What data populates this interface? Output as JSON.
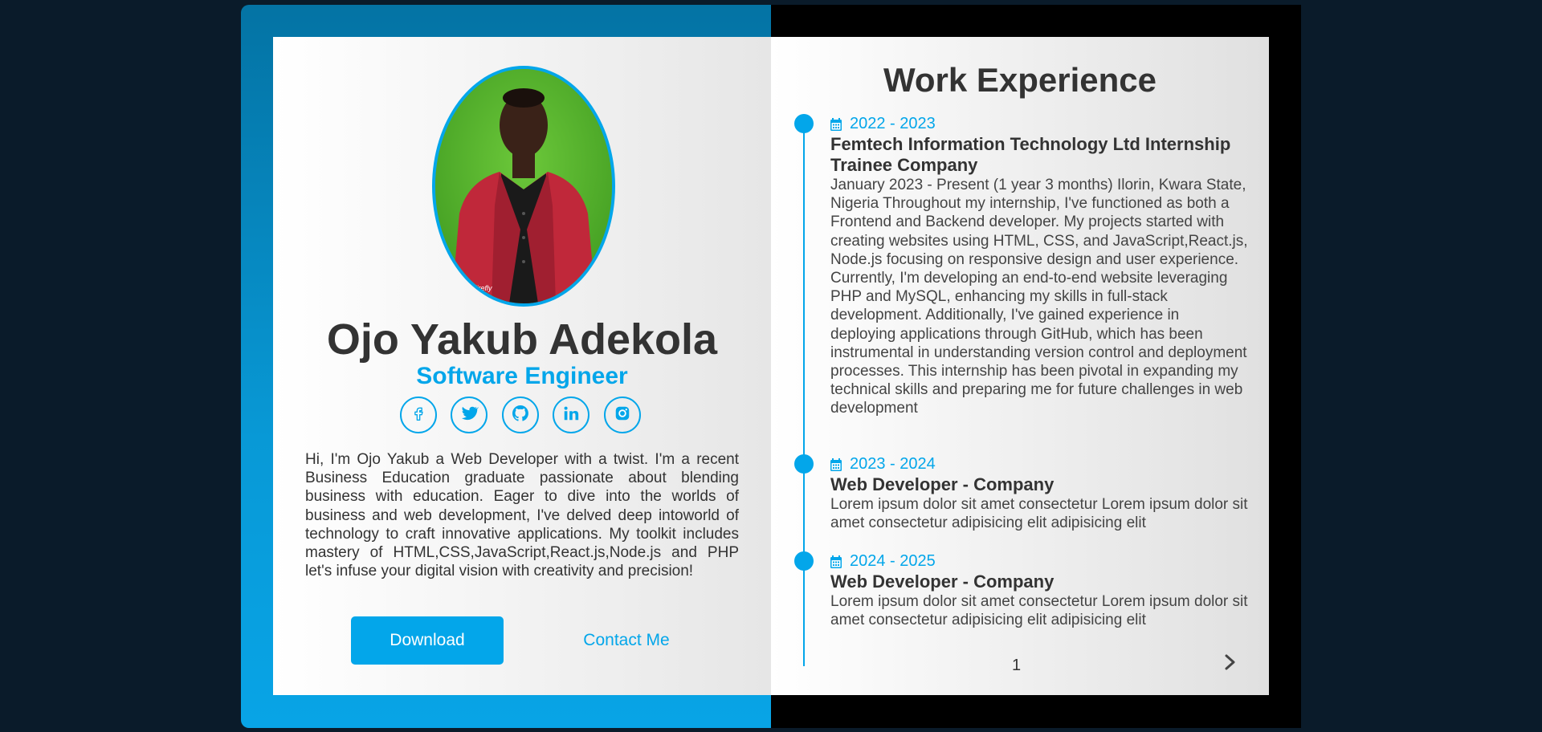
{
  "profile": {
    "name": "Ojo Yakub Adekola",
    "role": "Software Engineer",
    "about": "Hi, I'm Ojo Yakub a Web Developer with a twist. I'm a recent Business Education graduate passionate about blending business with education. Eager to dive into the worlds of business and web development, I've delved deep intoworld of technology to craft innovative applications. My toolkit includes mastery of HTML,CSS,JavaScript,React.js,Node.js and PHP let's infuse your digital vision with creativity and precision!",
    "photo_caption": "Firefly"
  },
  "socials": [
    {
      "icon": "facebook-icon"
    },
    {
      "icon": "twitter-icon"
    },
    {
      "icon": "github-icon"
    },
    {
      "icon": "linkedin-icon"
    },
    {
      "icon": "instagram-icon"
    }
  ],
  "buttons": {
    "download": "Download",
    "contact": "Contact Me"
  },
  "work": {
    "title": "Work Experience",
    "entries": [
      {
        "years": "2022 - 2023",
        "job": "Femtech Information Technology Ltd Internship Trainee Company",
        "desc": "January 2023 - Present (1 year 3 months) Ilorin, Kwara State, Nigeria Throughout my internship, I've functioned as both a Frontend and Backend developer. My projects started with creating websites using HTML, CSS, and JavaScript,React.js, Node.js focusing on responsive design and user experience. Currently, I'm developing an end-to-end website leveraging PHP and MySQL, enhancing my skills in full-stack development. Additionally, I've gained experience in deploying applications through GitHub, which has been instrumental in understanding version control and deployment processes. This internship has been pivotal in expanding my technical skills and preparing me for future challenges in web development"
      },
      {
        "years": "2023 - 2024",
        "job": "Web Developer - Company",
        "desc": "Lorem ipsum dolor sit amet consectetur Lorem ipsum dolor sit amet consectetur adipisicing elit adipisicing elit"
      },
      {
        "years": "2024 - 2025",
        "job": "Web Developer - Company",
        "desc": "Lorem ipsum dolor sit amet consectetur Lorem ipsum dolor sit amet consectetur adipisicing elit adipisicing elit"
      }
    ],
    "page_number": "1"
  },
  "colors": {
    "accent": "#03a6ea",
    "text": "#333333",
    "background": "#0a1b2a"
  }
}
